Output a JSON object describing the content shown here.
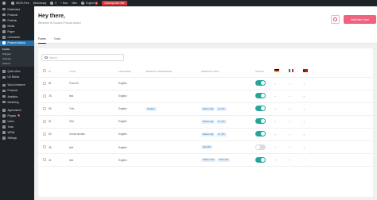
{
  "adminbar": {
    "site": "WCPA Free",
    "items": [
      "Wednesday",
      "0",
      "+ New",
      "Nitro",
      "English",
      "Development Site"
    ],
    "badge": "1"
  },
  "sidebar": {
    "items": [
      {
        "label": "Dashboard"
      },
      {
        "label": "Products"
      },
      {
        "label": "Portfolio"
      },
      {
        "label": "Media"
      },
      {
        "label": "Pages"
      },
      {
        "label": "Comments"
      },
      {
        "label": "Product Addons"
      }
    ],
    "submenu": [
      "Forms",
      "Widgets",
      "Settings",
      "Addons"
    ],
    "items2": [
      {
        "label": "Quick View"
      },
      {
        "label": "UX Blocks"
      },
      {
        "label": "WooCommerce"
      },
      {
        "label": "Products"
      },
      {
        "label": "Analytics"
      },
      {
        "label": "Marketing"
      },
      {
        "label": "Appearance"
      },
      {
        "label": "Plugins",
        "badge": "1"
      },
      {
        "label": "Users"
      },
      {
        "label": "Tools"
      },
      {
        "label": "WPML"
      },
      {
        "label": "Settings"
      }
    ]
  },
  "header": {
    "title": "Hey there,",
    "subtitle": "Welcome to Custom Product Addon",
    "add_label": "Add New Form"
  },
  "tabs": [
    "Forms",
    "Trash"
  ],
  "search": {
    "placeholder": "Search"
  },
  "table": {
    "headers": [
      "ID",
      "TITLE",
      "LANGUAGE",
      "PRODUCT CATEGORIES",
      "PRODUCT LISTS",
      "STATUS"
    ],
    "rows": [
      {
        "id": "81",
        "title": "Form #1",
        "lang": "English",
        "cats": [],
        "lists": [],
        "on": true
      },
      {
        "id": "78",
        "title": "test",
        "lang": "English",
        "cats": [],
        "lists": [],
        "on": true
      },
      {
        "id": "56",
        "title": "Tmh",
        "lang": "English",
        "cats": [
          "Hoodies"
        ],
        "lists": [
          "Beanie (20)",
          "Hr (76)"
        ],
        "on": true
      },
      {
        "id": "51",
        "title": "Test",
        "lang": "English",
        "cats": [],
        "lists": [
          "Beanie (20)",
          "Hr (76)"
        ],
        "on": true
      },
      {
        "id": "50",
        "title": "Check section",
        "lang": "English",
        "cats": [],
        "lists": [
          "Beanie (20)",
          "Hr (76)"
        ],
        "on": true
      },
      {
        "id": "48",
        "title": "test",
        "lang": "English",
        "cats": [],
        "lists": [
          "Belt (28)"
        ],
        "on": false
      },
      {
        "id": "44",
        "title": "test",
        "lang": "English",
        "cats": [],
        "lists": [
          "Plastic (124)",
          "Tshirt (25)"
        ],
        "on": true
      }
    ]
  },
  "colors": {
    "accent": "#f0637f",
    "toggle_on": "#26a69a",
    "sidebar": "#1d2327",
    "active": "#2271b1"
  }
}
